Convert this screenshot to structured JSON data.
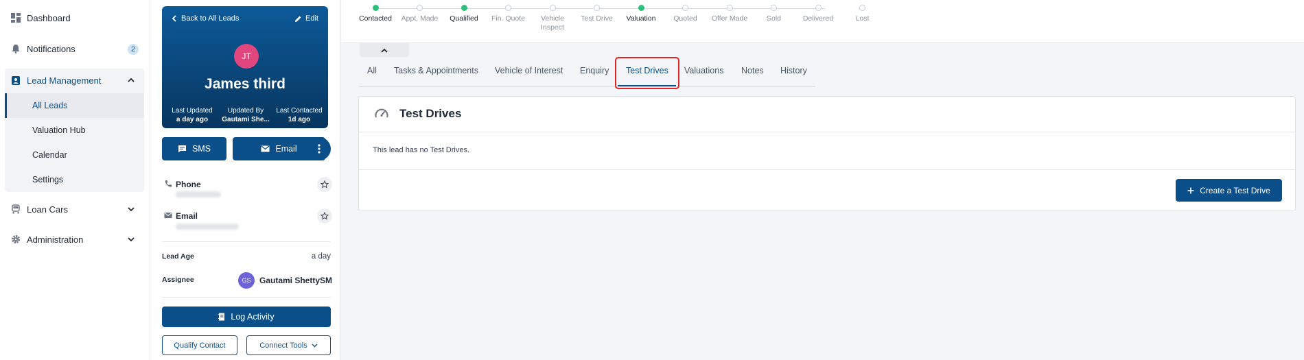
{
  "nav": {
    "dashboard": "Dashboard",
    "notifications": "Notifications",
    "notifications_count": "2",
    "lead_management": "Lead Management",
    "sub_items": [
      "All Leads",
      "Valuation Hub",
      "Calendar",
      "Settings"
    ],
    "loan_cars": "Loan Cars",
    "administration": "Administration"
  },
  "lead": {
    "back_label": "Back to All Leads",
    "edit_label": "Edit",
    "initials": "JT",
    "name": "James third",
    "meta": [
      {
        "label": "Last Updated",
        "value": "a day ago"
      },
      {
        "label": "Updated By",
        "value": "Gautami She..."
      },
      {
        "label": "Last Contacted",
        "value": "1d ago"
      }
    ],
    "sms_label": "SMS",
    "email_button_label": "Email",
    "phone_label": "Phone",
    "email_label": "Email",
    "lead_age_label": "Lead Age",
    "lead_age_value": "a day",
    "assignee_label": "Assignee",
    "assignee_initials": "GS",
    "assignee_name": "Gautami ShettySM",
    "log_activity": "Log Activity",
    "qualify_contact": "Qualify Contact",
    "connect_tools": "Connect Tools"
  },
  "stepper": {
    "steps": [
      {
        "label": "Contacted",
        "done": true
      },
      {
        "label": "Appt. Made",
        "done": false
      },
      {
        "label": "Qualified",
        "done": true
      },
      {
        "label": "Fin. Quote",
        "done": false
      },
      {
        "label": "Vehicle Inspect",
        "done": false
      },
      {
        "label": "Test Drive",
        "done": false
      },
      {
        "label": "Valuation",
        "done": true
      },
      {
        "label": "Quoted",
        "done": false
      },
      {
        "label": "Offer Made",
        "done": false
      },
      {
        "label": "Sold",
        "done": false
      },
      {
        "label": "Delivered",
        "done": false
      },
      {
        "label": "Lost",
        "done": false
      }
    ]
  },
  "tabs": [
    "All",
    "Tasks & Appointments",
    "Vehicle of Interest",
    "Enquiry",
    "Test Drives",
    "Valuations",
    "Notes",
    "History"
  ],
  "active_tab": "Test Drives",
  "test_drives": {
    "title": "Test Drives",
    "empty_message": "This lead has no Test Drives.",
    "create_button": "Create a Test Drive"
  },
  "colors": {
    "primary": "#0b4f8a",
    "done_step": "#2dbf7a",
    "highlight": "#e02424",
    "avatar_lead": "#e2467f",
    "avatar_assignee": "#6c63d8"
  }
}
